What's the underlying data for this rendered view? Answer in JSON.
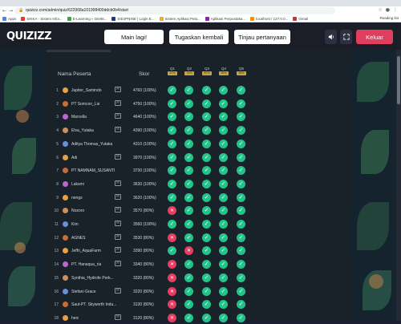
{
  "browser": {
    "url": "quizizz.com/admin/quiz/622968a101998400ddcb0b4/start",
    "bookmarks": [
      "Apps",
      "SIKKA - Sistem Infor...",
      "E-Learning » Direkt...",
      "SIDJPNINE | Login E...",
      "Sistem Aplikasi Pela...",
      "Aplikasi Perpustaka...",
      "localhost / 127.0.0...",
      "Gmail"
    ],
    "reading_list": "Reading list"
  },
  "header": {
    "logo": "QUIZIZZ",
    "play_again": "Main lagi!",
    "assign_again": "Tugaskan kembali",
    "review_questions": "Tinjau pertanyaan",
    "exit": "Keluar",
    "sound_icon": "speaker-icon",
    "fullscreen_icon": "fullscreen-icon"
  },
  "table": {
    "col_name": "Nama Peserta",
    "col_score": "Skor",
    "questions": [
      {
        "label": "Q1",
        "pct": "67%"
      },
      {
        "label": "Q2",
        "pct": "74%"
      },
      {
        "label": "Q3",
        "pct": "87%"
      },
      {
        "label": "Q4",
        "pct": "95%"
      },
      {
        "label": "Q5",
        "pct": "95%"
      }
    ],
    "rows": [
      {
        "rank": "1",
        "name": "Jupiter_Samindo",
        "mail": true,
        "score": "4760 (100%)",
        "avatar": "#e7a13f",
        "marks": [
          "ok",
          "ok",
          "ok",
          "ok",
          "ok"
        ]
      },
      {
        "rank": "2",
        "name": "PT Somcon_Lia",
        "mail": true,
        "score": "4750 (100%)",
        "avatar": "#c46e3a",
        "marks": [
          "ok",
          "ok",
          "ok",
          "ok",
          "ok"
        ]
      },
      {
        "rank": "3",
        "name": "Marcella",
        "mail": true,
        "score": "4640 (100%)",
        "avatar": "#b66ad0",
        "marks": [
          "ok",
          "ok",
          "ok",
          "ok",
          "ok"
        ]
      },
      {
        "rank": "4",
        "name": "Elva_Yutaka",
        "mail": true,
        "score": "4390 (100%)",
        "avatar": "#d08f5a",
        "marks": [
          "ok",
          "ok",
          "ok",
          "ok",
          "ok"
        ]
      },
      {
        "rank": "5",
        "name": "Aditya Thomas_Yutaka",
        "mail": false,
        "score": "4310 (100%)",
        "avatar": "#6a8fd6",
        "marks": [
          "ok",
          "ok",
          "ok",
          "ok",
          "ok"
        ]
      },
      {
        "rank": "6",
        "name": "Adi",
        "mail": true,
        "score": "3970 (100%)",
        "avatar": "#e7a13f",
        "marks": [
          "ok",
          "ok",
          "ok",
          "ok",
          "ok"
        ]
      },
      {
        "rank": "7",
        "name": "PT NAMNAM_SUSANTI",
        "mail": false,
        "score": "3730 (100%)",
        "avatar": "#c46e3a",
        "marks": [
          "ok",
          "ok",
          "ok",
          "ok",
          "ok"
        ]
      },
      {
        "rank": "8",
        "name": "Laksmi",
        "mail": true,
        "score": "3630 (100%)",
        "avatar": "#b66ad0",
        "marks": [
          "ok",
          "ok",
          "ok",
          "ok",
          "ok"
        ]
      },
      {
        "rank": "9",
        "name": "nengs",
        "mail": true,
        "score": "3620 (100%)",
        "avatar": "#e7a13f",
        "marks": [
          "ok",
          "ok",
          "ok",
          "ok",
          "ok"
        ]
      },
      {
        "rank": "10",
        "name": "Nozoro",
        "mail": true,
        "score": "3570 (80%)",
        "avatar": "#d08f5a",
        "marks": [
          "bad",
          "ok",
          "ok",
          "ok",
          "ok"
        ]
      },
      {
        "rank": "11",
        "name": "Kim",
        "mail": true,
        "score": "3560 (100%)",
        "avatar": "#6a8fd6",
        "marks": [
          "ok",
          "ok",
          "ok",
          "ok",
          "ok"
        ]
      },
      {
        "rank": "12",
        "name": "AGNES",
        "mail": true,
        "score": "3530 (80%)",
        "avatar": "#c46e3a",
        "marks": [
          "bad",
          "ok",
          "ok",
          "ok",
          "ok"
        ]
      },
      {
        "rank": "13",
        "name": "Jeffri_AquaFarm",
        "mail": true,
        "score": "3390 (80%)",
        "avatar": "#e7a13f",
        "marks": [
          "ok",
          "bad",
          "ok",
          "ok",
          "ok"
        ]
      },
      {
        "rank": "14",
        "name": "PT. Hanaqua_ria",
        "mail": true,
        "score": "3340 (80%)",
        "avatar": "#b66ad0",
        "marks": [
          "bad",
          "ok",
          "ok",
          "ok",
          "ok"
        ]
      },
      {
        "rank": "15",
        "name": "Synthia_Hydrofe Perk...",
        "mail": false,
        "score": "3320 (80%)",
        "avatar": "#d08f5a",
        "marks": [
          "bad",
          "ok",
          "ok",
          "ok",
          "ok"
        ]
      },
      {
        "rank": "16",
        "name": "Stefani Grace",
        "mail": true,
        "score": "3220 (80%)",
        "avatar": "#6a8fd6",
        "marks": [
          "bad",
          "ok",
          "ok",
          "ok",
          "ok"
        ]
      },
      {
        "rank": "17",
        "name": "Saut-PT. Skyworth Indu...",
        "mail": false,
        "score": "3130 (80%)",
        "avatar": "#c46e3a",
        "marks": [
          "bad",
          "ok",
          "ok",
          "ok",
          "ok"
        ]
      },
      {
        "rank": "18",
        "name": "heni",
        "mail": true,
        "score": "3120 (80%)",
        "avatar": "#e7a13f",
        "marks": [
          "bad",
          "ok",
          "ok",
          "ok",
          "ok"
        ]
      }
    ]
  },
  "colors": {
    "correct": "#23c489",
    "incorrect": "#e53e62",
    "exit": "#e03e5f",
    "pct_badge": "#c9a641"
  }
}
